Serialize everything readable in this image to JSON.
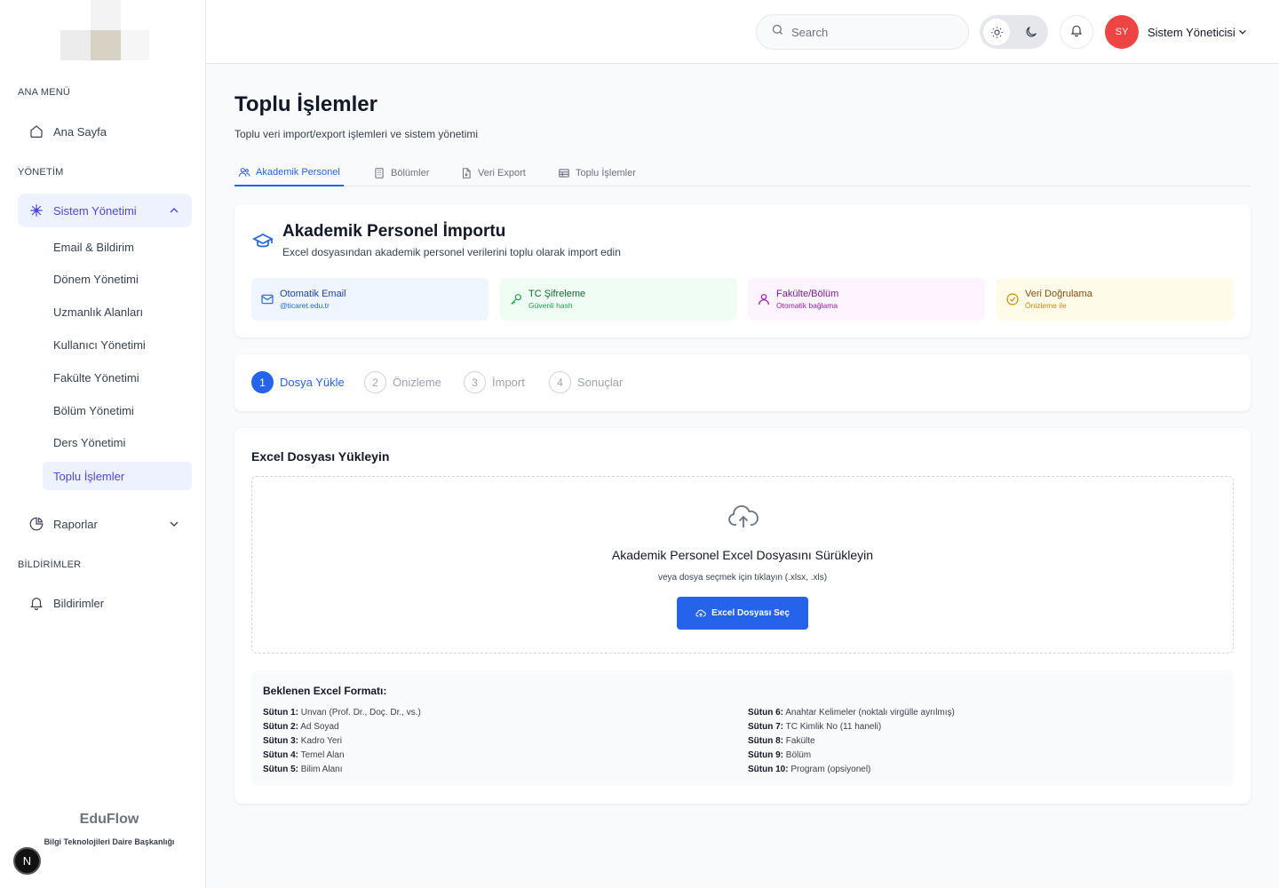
{
  "sidebar": {
    "sections": {
      "main": "ANA MENÜ",
      "admin": "YÖNETİM",
      "notifications": "BİLDİRİMLER"
    },
    "home": "Ana Sayfa",
    "system_admin": "Sistem Yönetimi",
    "sub_items": [
      "Email & Bildirim",
      "Dönem Yönetimi",
      "Uzmanlık Alanları",
      "Kullanıcı Yönetimi",
      "Fakülte Yönetimi",
      "Bölüm Yönetimi",
      "Ders Yönetimi",
      "Toplu İşlemler"
    ],
    "reports": "Raporlar",
    "notifications_item": "Bildirimler",
    "brand": "EduFlow",
    "brand_sub": "Bilgi Teknolojileri Daire Başkanlığı",
    "badge": "N"
  },
  "header": {
    "search_placeholder": "Search",
    "avatar_initials": "SY",
    "user_name": "Sistem Yöneticisi"
  },
  "page": {
    "title": "Toplu İşlemler",
    "subtitle": "Toplu veri import/export işlemleri ve sistem yönetimi",
    "tabs": [
      "Akademik Personel",
      "Bölümler",
      "Veri Export",
      "Toplu İşlemler"
    ]
  },
  "import_card": {
    "title": "Akademik Personel İmportu",
    "subtitle": "Excel dosyasından akademik personel verilerini toplu olarak import edin",
    "features": [
      {
        "title": "Otomatik Email",
        "sub": "@ticaret.edu.tr",
        "bg": "#eff6ff",
        "color": "#1e40af"
      },
      {
        "title": "TC Şifreleme",
        "sub": "Güvenli hash",
        "bg": "#f0fdf4",
        "color": "#166534"
      },
      {
        "title": "Fakülte/Bölüm",
        "sub": "Otomatik bağlama",
        "bg": "#fdf4ff",
        "color": "#86198f"
      },
      {
        "title": "Veri Doğrulama",
        "sub": "Önizleme ile",
        "bg": "#fefce8",
        "color": "#854d0e"
      }
    ]
  },
  "steps": [
    {
      "num": "1",
      "label": "Dosya Yükle"
    },
    {
      "num": "2",
      "label": "Önizleme"
    },
    {
      "num": "3",
      "label": "İmport"
    },
    {
      "num": "4",
      "label": "Sonuçlar"
    }
  ],
  "upload": {
    "title": "Excel Dosyası Yükleyin",
    "dz_title": "Akademik Personel Excel Dosyasını Sürükleyin",
    "dz_sub": "veya dosya seçmek için tıklayın (.xlsx, .xls)",
    "button": "Excel Dosyası Seç",
    "format_title": "Beklenen Excel Formatı:",
    "columns_left": [
      {
        "k": "Sütun 1:",
        "v": "Unvan (Prof. Dr., Doç. Dr., vs.)"
      },
      {
        "k": "Sütun 2:",
        "v": "Ad Soyad"
      },
      {
        "k": "Sütun 3:",
        "v": "Kadro Yeri"
      },
      {
        "k": "Sütun 4:",
        "v": "Temel Alan"
      },
      {
        "k": "Sütun 5:",
        "v": "Bilim Alanı"
      }
    ],
    "columns_right": [
      {
        "k": "Sütun 6:",
        "v": "Anahtar Kelimeler (noktalı virgülle ayrılmış)"
      },
      {
        "k": "Sütun 7:",
        "v": "TC Kimlik No (11 haneli)"
      },
      {
        "k": "Sütun 8:",
        "v": "Fakülte"
      },
      {
        "k": "Sütun 9:",
        "v": "Bölüm"
      },
      {
        "k": "Sütun 10:",
        "v": "Program (opsiyonel)"
      }
    ]
  }
}
